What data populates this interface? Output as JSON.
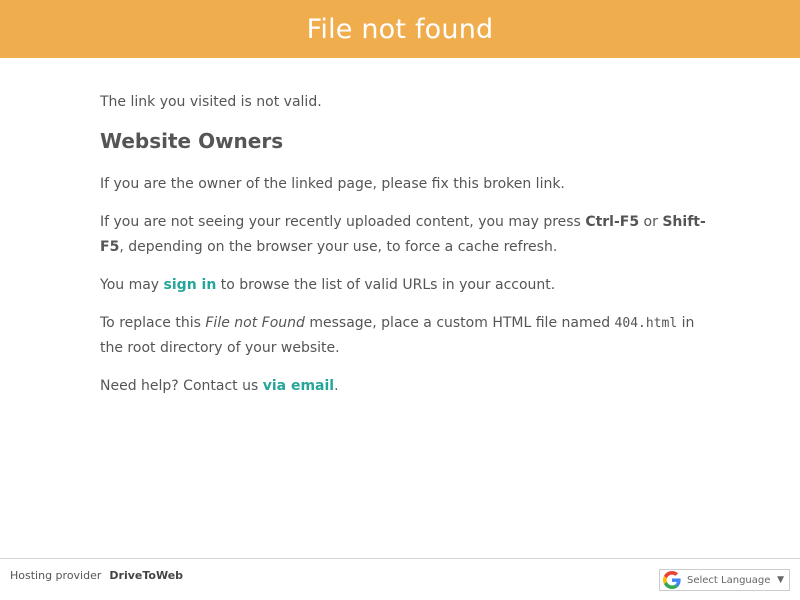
{
  "banner": {
    "title": "File not found"
  },
  "content": {
    "intro": "The link you visited is not valid.",
    "heading": "Website Owners",
    "owner_fix": "If you are the owner of the linked page, please fix this broken link.",
    "cache": {
      "before": "If you are not seeing your recently uploaded content, you may press ",
      "key1": "Ctrl-F5",
      "mid": " or ",
      "key2": "Shift-F5",
      "after": ", depending on the browser your use, to force a cache refresh."
    },
    "signin": {
      "before": "You may ",
      "link": "sign in",
      "after": " to browse the list of valid URLs in your account."
    },
    "replace": {
      "before": "To replace this ",
      "em": "File not Found",
      "mid": " message, place a custom HTML file named ",
      "code": "404.html",
      "after": " in the root directory of your website."
    },
    "help": {
      "before": "Need help? Contact us ",
      "link": "via email",
      "after": "."
    }
  },
  "footer": {
    "provider_label": "Hosting provider",
    "provider_name": "DriveToWeb",
    "language": {
      "label": "Select Language",
      "caret": "▼",
      "icon": "google-g-icon"
    }
  },
  "colors": {
    "banner": "#f0ad4e",
    "link": "#26a69a",
    "text": "#555555"
  }
}
